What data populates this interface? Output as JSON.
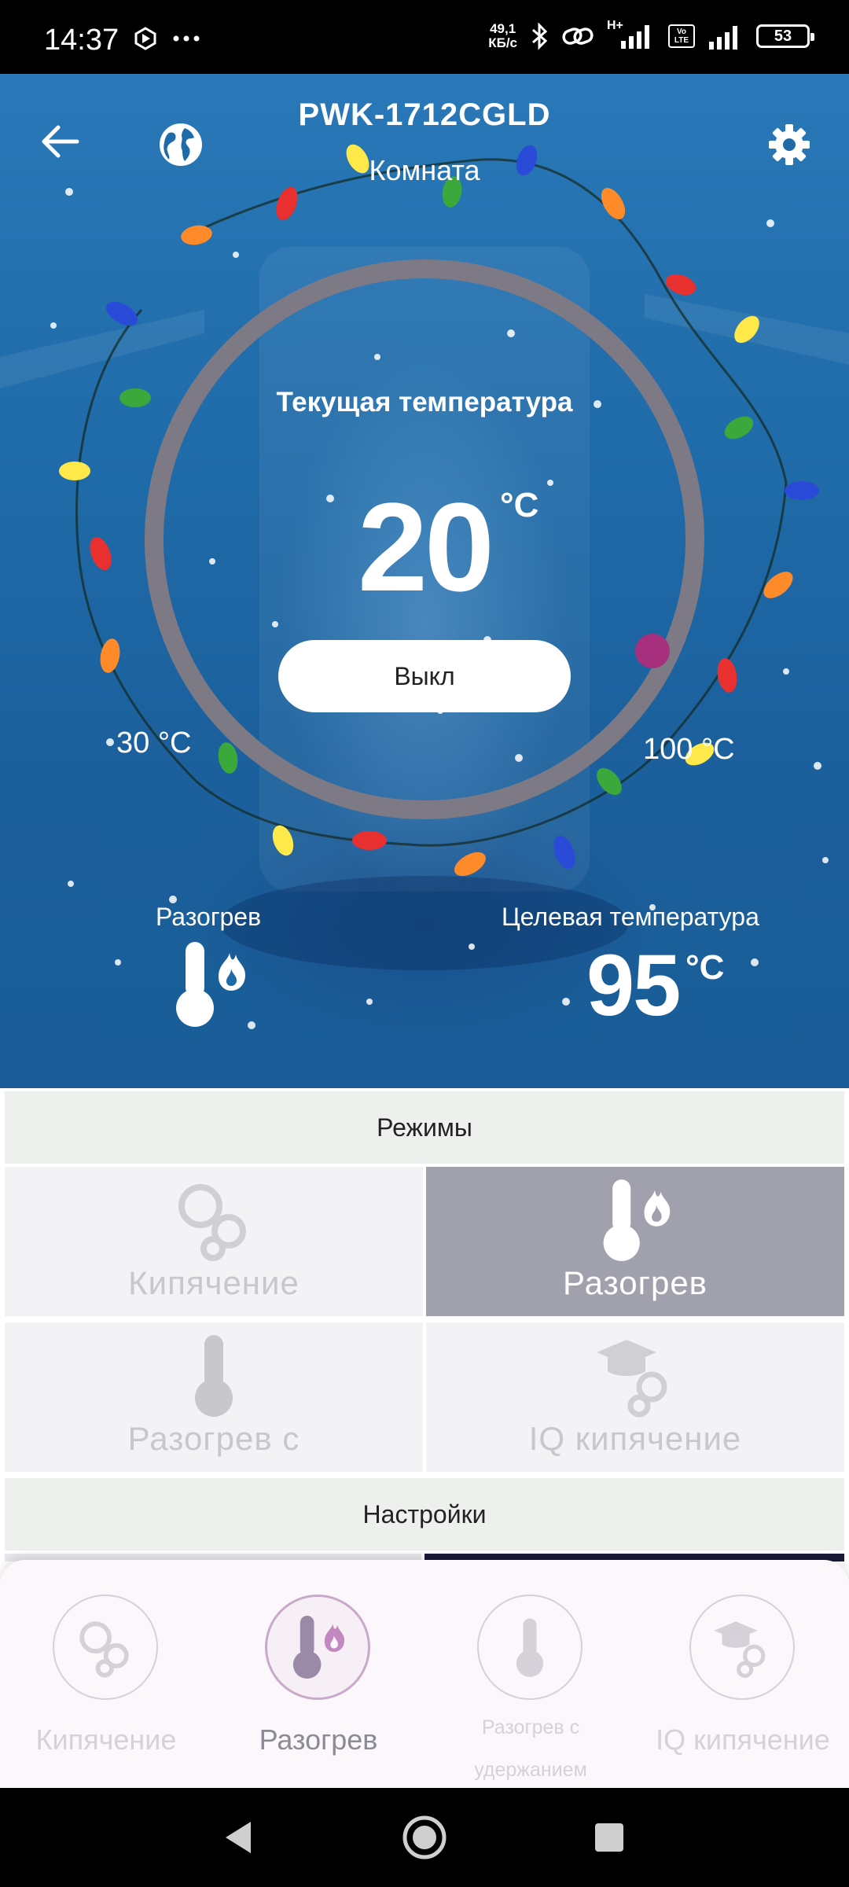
{
  "status_bar": {
    "time": "14:37",
    "net_speed_value": "49,1",
    "net_speed_unit": "КБ/с",
    "network_type": "H+",
    "lte_label_top": "Vo",
    "lte_label_bottom": "LTE",
    "battery": "53"
  },
  "header": {
    "device_name": "PWK-1712CGLD",
    "room": "Комната"
  },
  "thermo": {
    "current_label": "Текущая температура",
    "current_value": "20",
    "unit": "°C",
    "power_button": "Выкл",
    "range_min": "30 °C",
    "range_max": "100 °C",
    "mode_label": "Разогрев",
    "target_label": "Целевая температура",
    "target_value": "95",
    "target_unit": "°C"
  },
  "modes": {
    "header": "Режимы",
    "items": [
      {
        "label": "Кипячение",
        "icon": "bubbles-icon",
        "active": false
      },
      {
        "label": "Разогрев",
        "icon": "thermometer-flame-icon",
        "active": true
      },
      {
        "label": "Разогрев с",
        "icon": "thermometer-icon",
        "active": false
      },
      {
        "label": "IQ кипячение",
        "icon": "graduation-bubbles-icon",
        "active": false
      }
    ]
  },
  "settings": {
    "header": "Настройки"
  },
  "bottom_nav": {
    "items": [
      {
        "label": "Кипячение",
        "icon": "bubbles-icon",
        "active": false
      },
      {
        "label": "Разогрев",
        "icon": "thermometer-flame-icon",
        "active": true
      },
      {
        "label": "Разогрев с удержанием",
        "icon": "thermometer-icon",
        "active": false
      },
      {
        "label": "IQ кипячение",
        "icon": "graduation-bubbles-icon",
        "active": false
      }
    ]
  },
  "colors": {
    "hero_blue": "#1f6aa8",
    "ring": "#7e7a85",
    "ring_knob": "#a7307e",
    "active_tile": "#a1a1ae",
    "inactive_text": "#c8c8cc"
  }
}
